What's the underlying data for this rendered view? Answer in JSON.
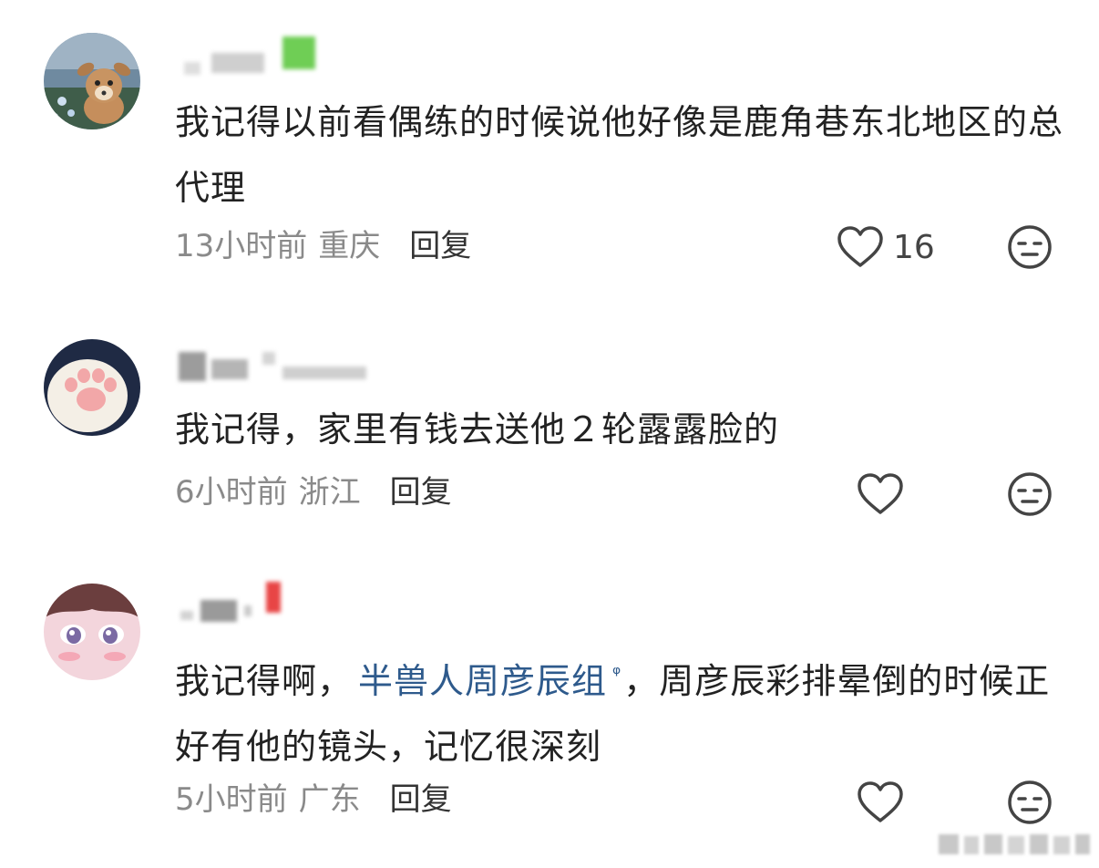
{
  "comments": [
    {
      "text": "我记得以前看偶练的时候说他好像是鹿角巷东北地区的总代理",
      "time": "13小时前",
      "location": "重庆",
      "reply_label": "回复",
      "likes": "16",
      "icons": {
        "avatar": "deer-plush-avatar",
        "like": "heart-outline-icon",
        "dislike": "meh-face-icon"
      }
    },
    {
      "text": "我记得，家里有钱去送他２轮露露脸的",
      "time": "6小时前",
      "location": "浙江",
      "reply_label": "回复",
      "icons": {
        "avatar": "cat-paw-avatar",
        "like": "heart-outline-icon",
        "dislike": "meh-face-icon"
      }
    },
    {
      "text_before": "我记得啊，",
      "topic": "半兽人周彦辰组",
      "text_after": "，周彦辰彩排晕倒的时候正好有他的镜头，记忆很深刻",
      "time": "5小时前",
      "location": "广东",
      "reply_label": "回复",
      "icons": {
        "avatar": "anime-girl-avatar",
        "topic": "search-icon",
        "like": "heart-outline-icon",
        "dislike": "meh-face-icon"
      }
    }
  ],
  "colors": {
    "text": "#222222",
    "meta": "#8a8a8a",
    "topic": "#2e5a8c",
    "icon": "#444444"
  }
}
